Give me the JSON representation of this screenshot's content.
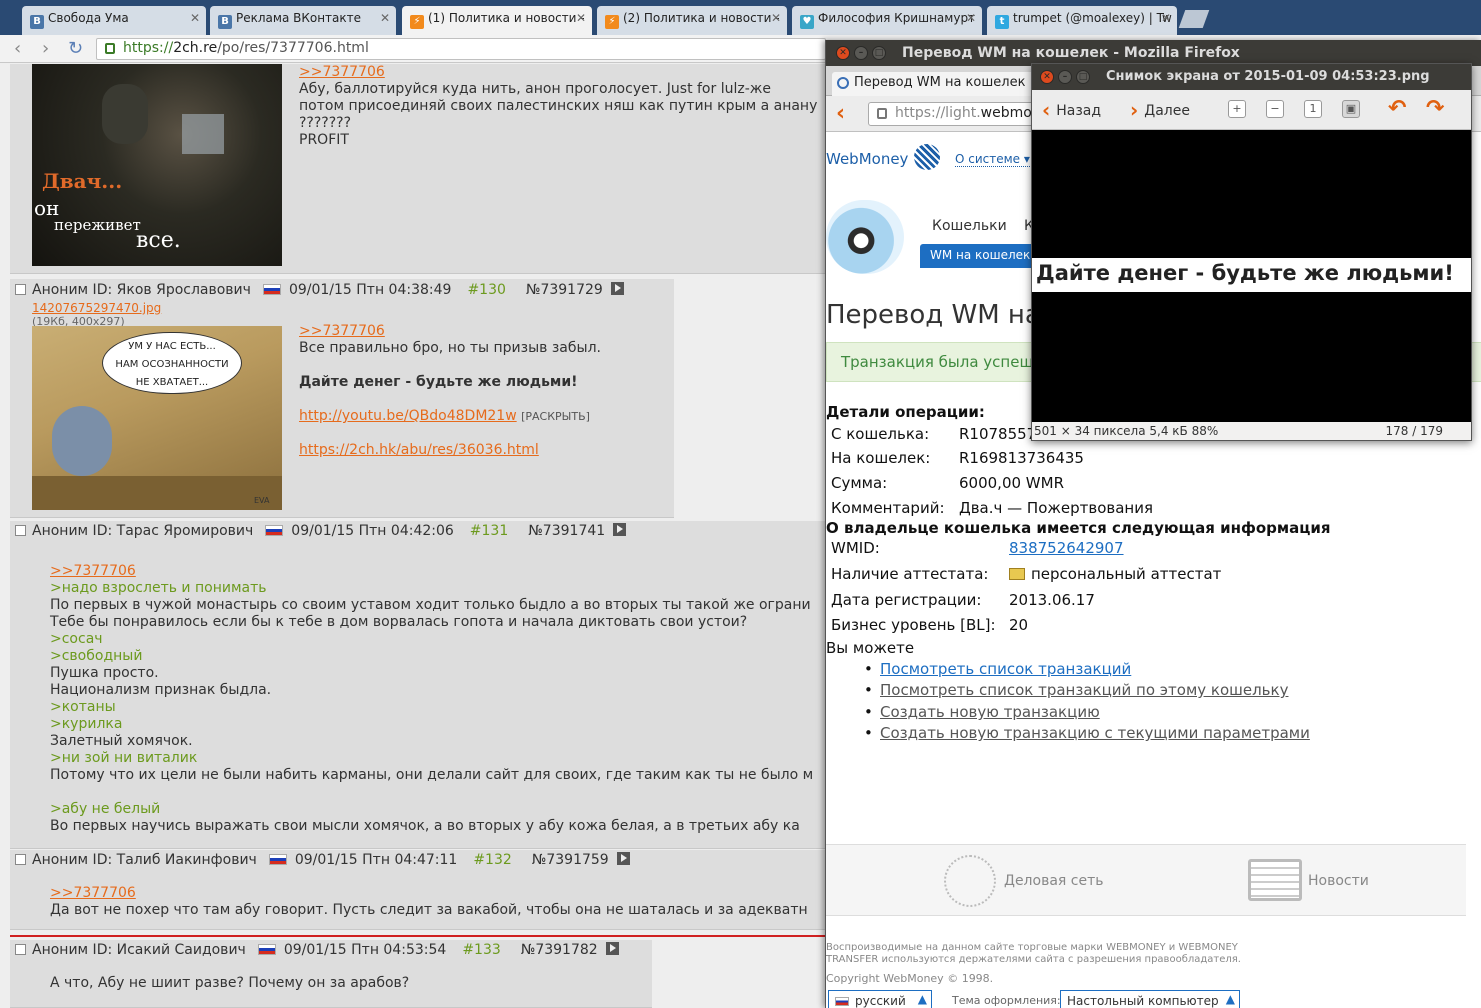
{
  "tabs": [
    {
      "label": "Свобода Ума",
      "favicon": "vk-icon"
    },
    {
      "label": "Реклама ВКонтакте",
      "favicon": "vk-icon"
    },
    {
      "label": "(1) Политика и новости -",
      "favicon": "dvach-icon"
    },
    {
      "label": "(2) Политика и новости -",
      "favicon": "dvach-icon"
    },
    {
      "label": "Философия Кришнамурт",
      "favicon": "heart-icon"
    },
    {
      "label": "trumpet (@moalexey) | Tw",
      "favicon": "twitter-icon"
    }
  ],
  "url": {
    "scheme": "https://",
    "host": "2ch.re",
    "path": "/po/res/7377706.html"
  },
  "posts": [
    {
      "reply_link": ">>7377706",
      "lines": [
        "Абу, баллотируйся куда нить, анон проголосует. Just for lulz-же",
        "потом присоединяй своих палестинских няш как путин крым а анану",
        "???????",
        "PROFIT"
      ],
      "thumb_caption": [
        "Двач...",
        "он",
        "переживет",
        "все."
      ]
    },
    {
      "author": "Аноним ID: Яков Ярославович",
      "date": "09/01/15 Птн 04:38:49",
      "number": "#130",
      "post_id": "№7391729",
      "file_name": "14207675297470.jpg",
      "file_meta": "(19Кб, 400x297)",
      "reply_link": ">>7377706",
      "line1": "Все правильно бро, но ты призыв забыл.",
      "bold_line": "Дайте денег - будьте же людьми!",
      "link1": "http://youtu.be/QBdo48DM21w",
      "expand": "[РАСКРЫТЬ]",
      "link2": "https://2ch.hk/abu/res/36036.html",
      "bubble": [
        "УМ У НАС ЕСТЬ...",
        "НАМ ОСОЗНАННОСТИ",
        "НЕ ХВАТАЕТ..."
      ],
      "thumb_sign": "EVA"
    },
    {
      "author": "Аноним ID: Тарас Яромирович",
      "date": "09/01/15 Птн 04:42:06",
      "number": "#131",
      "post_id": "№7391741",
      "lines": [
        {
          "t": ">>7377706",
          "k": "ref"
        },
        {
          "t": ">надо взрослеть и понимать",
          "k": "quote"
        },
        {
          "t": "По первых в чужой монастырь со своим уставом ходит только быдло а во вторых ты такой же ограни",
          "k": "text"
        },
        {
          "t": "Тебе бы понравилось если бы к тебе в дом ворвалась гопота и начала диктовать свои устои?",
          "k": "text"
        },
        {
          "t": ">сосач",
          "k": "quote"
        },
        {
          "t": ">свободный",
          "k": "quote"
        },
        {
          "t": "Пушка просто.",
          "k": "text"
        },
        {
          "t": "Национализм признак быдла.",
          "k": "text"
        },
        {
          "t": ">котаны",
          "k": "quote"
        },
        {
          "t": ">курилка",
          "k": "quote"
        },
        {
          "t": "Залетный хомячок.",
          "k": "text"
        },
        {
          "t": ">ни зой ни виталик",
          "k": "quote"
        },
        {
          "t": "Потому что их цели не были набить карманы, они делали сайт для своих, где таким как ты не было м",
          "k": "text"
        },
        {
          "t": "",
          "k": "text"
        },
        {
          "t": ">абу не белый",
          "k": "quote"
        },
        {
          "t": "Во первых научись выражать свои мысли хомячок, а во вторых у абу кожа белая, а в третьих абу ка",
          "k": "text"
        }
      ]
    },
    {
      "author": "Аноним ID: Талиб Иакинфович",
      "date": "09/01/15 Птн 04:47:11",
      "number": "#132",
      "post_id": "№7391759",
      "reply_link": ">>7377706",
      "line1": "Да вот не похер что там абу говорит. Пусть следит за вакабой, чтобы она не шаталась и за адекватн"
    },
    {
      "author": "Аноним ID: Исакий Саидович",
      "date": "09/01/15 Птн 04:53:54",
      "number": "#133",
      "post_id": "№7391782",
      "line1": "А что, Абу не шиит разве? Почему он за арабов?"
    }
  ],
  "firefox": {
    "title": "Перевод WM на кошелек - Mozilla Firefox",
    "tab": "Перевод WM на кошелек",
    "url_scheme": "https://light.",
    "url_host": "webmo"
  },
  "webmoney": {
    "logo": "WebMoney",
    "about": "О системе ▾",
    "nav1": "Кошельки",
    "nav2": "К",
    "subtab": "WM на кошелек",
    "heading": "Перевод WM на",
    "success": "Транзакция была успеш",
    "details_title": "Детали операции:",
    "rows": [
      {
        "label": "С кошелька:",
        "value": "R1078557"
      },
      {
        "label": "На кошелек:",
        "value": "R169813736435"
      },
      {
        "label": "Сумма:",
        "value": "6000,00 WMR"
      },
      {
        "label": "Комментарий:",
        "value": "Два.ч — Пожертвования"
      }
    ],
    "owner_title": "О владельце кошелька имеется следующая информация",
    "owner_rows": [
      {
        "label": "WMID:",
        "value": "838752642907"
      },
      {
        "label": "Наличие аттестата:",
        "value": "персональный аттестат"
      },
      {
        "label": "Дата регистрации:",
        "value": "2013.06.17"
      },
      {
        "label": "Бизнес уровень [BL]:",
        "value": "20"
      }
    ],
    "can_title": "Вы можете",
    "actions": [
      "Посмотреть список транзакций",
      "Посмотреть список транзакций по этому кошельку",
      "Создать новую транзакцию",
      "Создать новую транзакцию с текущими параметрами"
    ],
    "footer_delo": "Деловая сеть",
    "footer_news": "Новости",
    "legal": "Воспроизводимые на данном сайте торговые марки WEBMONEY и WEBMONEY TRANSFER используются держателями сайта с разрешения правообладателя.",
    "copyright": "Copyright WebMoney © 1998.",
    "lang": "русский",
    "theme_label": "Тема оформления:",
    "theme_value": "Настольный компьютер"
  },
  "viewer": {
    "title": "Снимок экрана от 2015-01-09 04:53:23.png",
    "back": "Назад",
    "forward": "Далее",
    "image_text": "Дайте денег - будьте же людьми!",
    "status": "501 × 34 пиксела  5,4 кБ   88%",
    "pages": "178 / 179"
  },
  "colors": {
    "reflink": "#e66b1c",
    "quote": "#6c9a1e",
    "wm_blue": "#1d6ec2",
    "ubuntu_close": "#dd4a1e"
  }
}
